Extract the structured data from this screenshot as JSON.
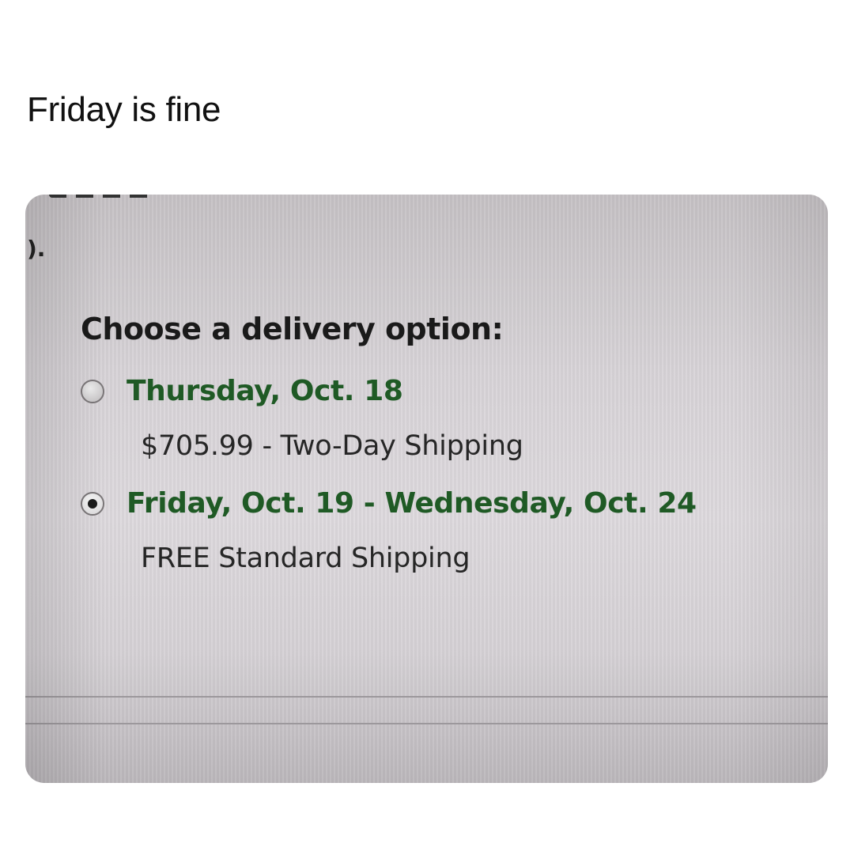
{
  "post": {
    "caption": "Friday is fine"
  },
  "screen": {
    "corner_fragment": ").",
    "heading": "Choose a delivery option:",
    "options": [
      {
        "date": "Thursday, Oct. 18",
        "description": "$705.99 - Two-Day Shipping",
        "selected": false
      },
      {
        "date": "Friday, Oct. 19 - Wednesday, Oct. 24",
        "description": "FREE Standard Shipping",
        "selected": true
      }
    ]
  },
  "colors": {
    "date_text": "#1f5a25",
    "body_text": "#262626"
  }
}
